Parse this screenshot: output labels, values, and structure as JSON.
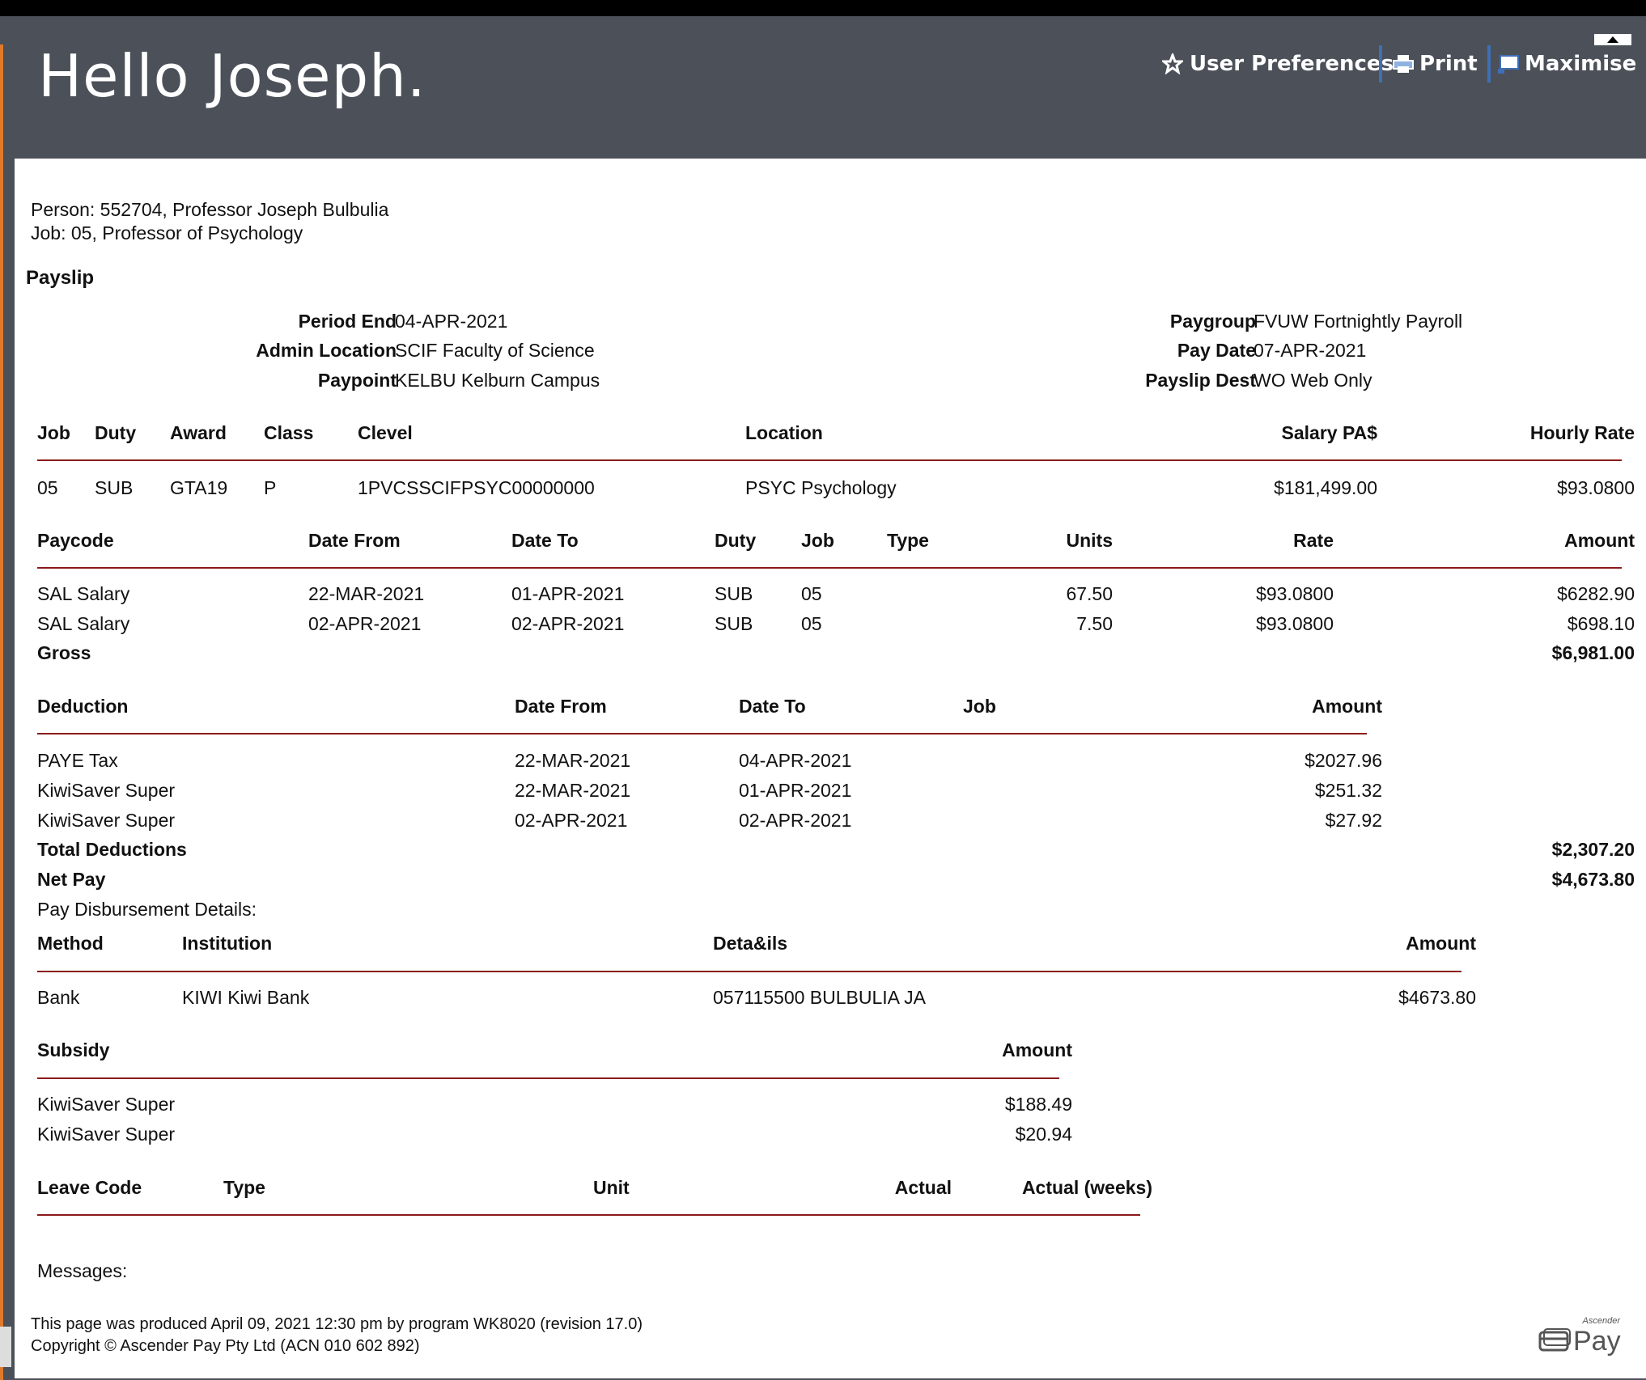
{
  "header": {
    "greeting": "Hello Joseph.",
    "links": [
      {
        "label": "User Preferences",
        "icon": "star-icon"
      },
      {
        "label": "Print",
        "icon": "printer-icon"
      },
      {
        "label": "Maximise",
        "icon": "maximise-icon"
      }
    ]
  },
  "person": {
    "person_line": "Person: 552704, Professor Joseph Bulbulia",
    "job_line": "Job: 05, Professor of Psychology"
  },
  "payslip": {
    "heading": "Payslip",
    "fields_left": [
      {
        "label": "Period End",
        "value": "04-APR-2021"
      },
      {
        "label": "Admin Location",
        "value": "SCIF Faculty of Science"
      },
      {
        "label": "Paypoint",
        "value": "KELBU Kelburn Campus"
      }
    ],
    "fields_right": [
      {
        "label": "Paygroup",
        "value": "FVUW Fortnightly Payroll"
      },
      {
        "label": "Pay Date",
        "value": "07-APR-2021"
      },
      {
        "label": "Payslip Dest",
        "value": "WO Web Only"
      }
    ]
  },
  "job_table": {
    "headers": [
      "Job",
      "Duty",
      "Award",
      "Class",
      "Clevel",
      "Location",
      "Salary PA$",
      "Hourly Rate"
    ],
    "row": [
      "05",
      "SUB",
      "GTA19",
      "P",
      "1PVCSSCIFPSYC00000000",
      "PSYC Psychology",
      "$181,499.00",
      "$93.0800"
    ]
  },
  "paycode_table": {
    "headers": [
      "Paycode",
      "Date From",
      "Date To",
      "Duty",
      "Job",
      "Type",
      "Units",
      "Rate",
      "Amount"
    ],
    "rows": [
      [
        "SAL Salary",
        "22-MAR-2021",
        "01-APR-2021",
        "SUB",
        "05",
        "",
        "67.50",
        "$93.0800",
        "$6282.90"
      ],
      [
        "SAL Salary",
        "02-APR-2021",
        "02-APR-2021",
        "SUB",
        "05",
        "",
        "7.50",
        "$93.0800",
        "$698.10"
      ]
    ],
    "gross_label": "Gross",
    "gross_value": "$6,981.00"
  },
  "deduction_table": {
    "headers": [
      "Deduction",
      "Date From",
      "Date To",
      "Job",
      "Amount"
    ],
    "rows": [
      [
        "PAYE Tax",
        "22-MAR-2021",
        "04-APR-2021",
        "",
        "$2027.96"
      ],
      [
        "KiwiSaver Super",
        "22-MAR-2021",
        "01-APR-2021",
        "",
        "$251.32"
      ],
      [
        "KiwiSaver Super",
        "02-APR-2021",
        "02-APR-2021",
        "",
        "$27.92"
      ]
    ],
    "total_label": "Total Deductions",
    "total_value": "$2,307.20",
    "net_label": "Net Pay",
    "net_value": "$4,673.80"
  },
  "disbursement": {
    "title": "Pay Disbursement Details:",
    "headers": [
      "Method",
      "Institution",
      "Deta&ils",
      "Amount"
    ],
    "row": [
      "Bank",
      "KIWI Kiwi Bank",
      "057115500 BULBULIA JA",
      "$4673.80"
    ]
  },
  "subsidy": {
    "headers": [
      "Subsidy",
      "Amount"
    ],
    "rows": [
      [
        "KiwiSaver Super",
        "$188.49"
      ],
      [
        "KiwiSaver Super",
        "$20.94"
      ]
    ]
  },
  "leave": {
    "headers": [
      "Leave Code",
      "Type",
      "Unit",
      "Actual",
      "Actual (weeks)"
    ]
  },
  "messages_label": "Messages:",
  "footer": {
    "produced": "This page was produced April 09, 2021 12:30 pm by program WK8020 (revision 17.0)",
    "copyright": "Copyright © Ascender Pay Pty Ltd (ACN 010 602 892)",
    "logo_small": "Ascender",
    "logo_big": "Pay"
  }
}
